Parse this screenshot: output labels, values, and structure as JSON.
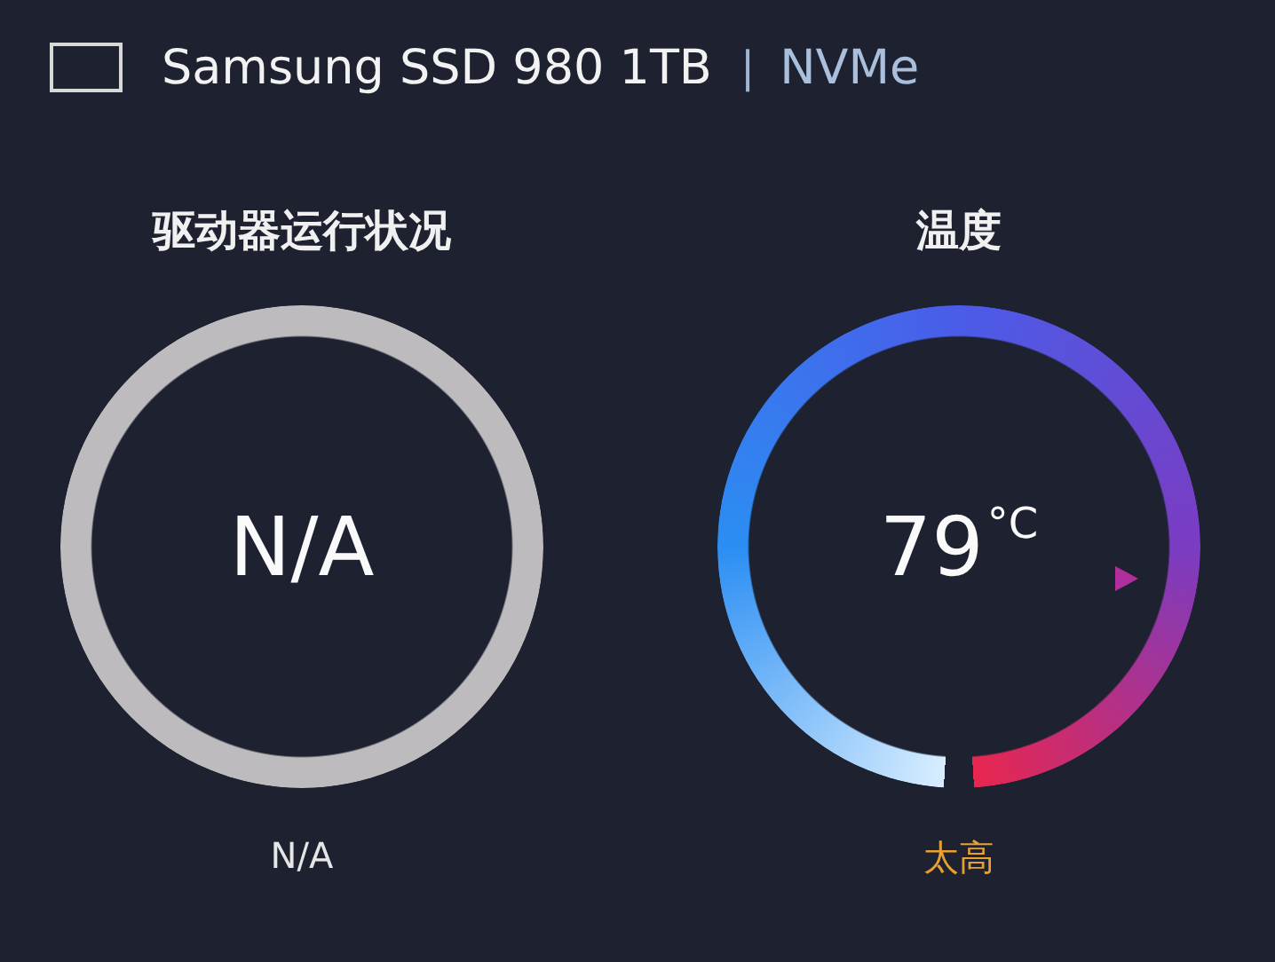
{
  "header": {
    "title": "Samsung SSD 980 1TB",
    "separator": "|",
    "interface": "NVMe"
  },
  "panels": [
    {
      "kind": "health",
      "title": "驱动器运行状况",
      "value": "N/A",
      "status": "N/A",
      "color": "#e6e6e6"
    },
    {
      "kind": "temperature",
      "title": "温度",
      "value": "79",
      "unit": "°C",
      "status": "太高",
      "color": "#e8a030"
    }
  ]
}
